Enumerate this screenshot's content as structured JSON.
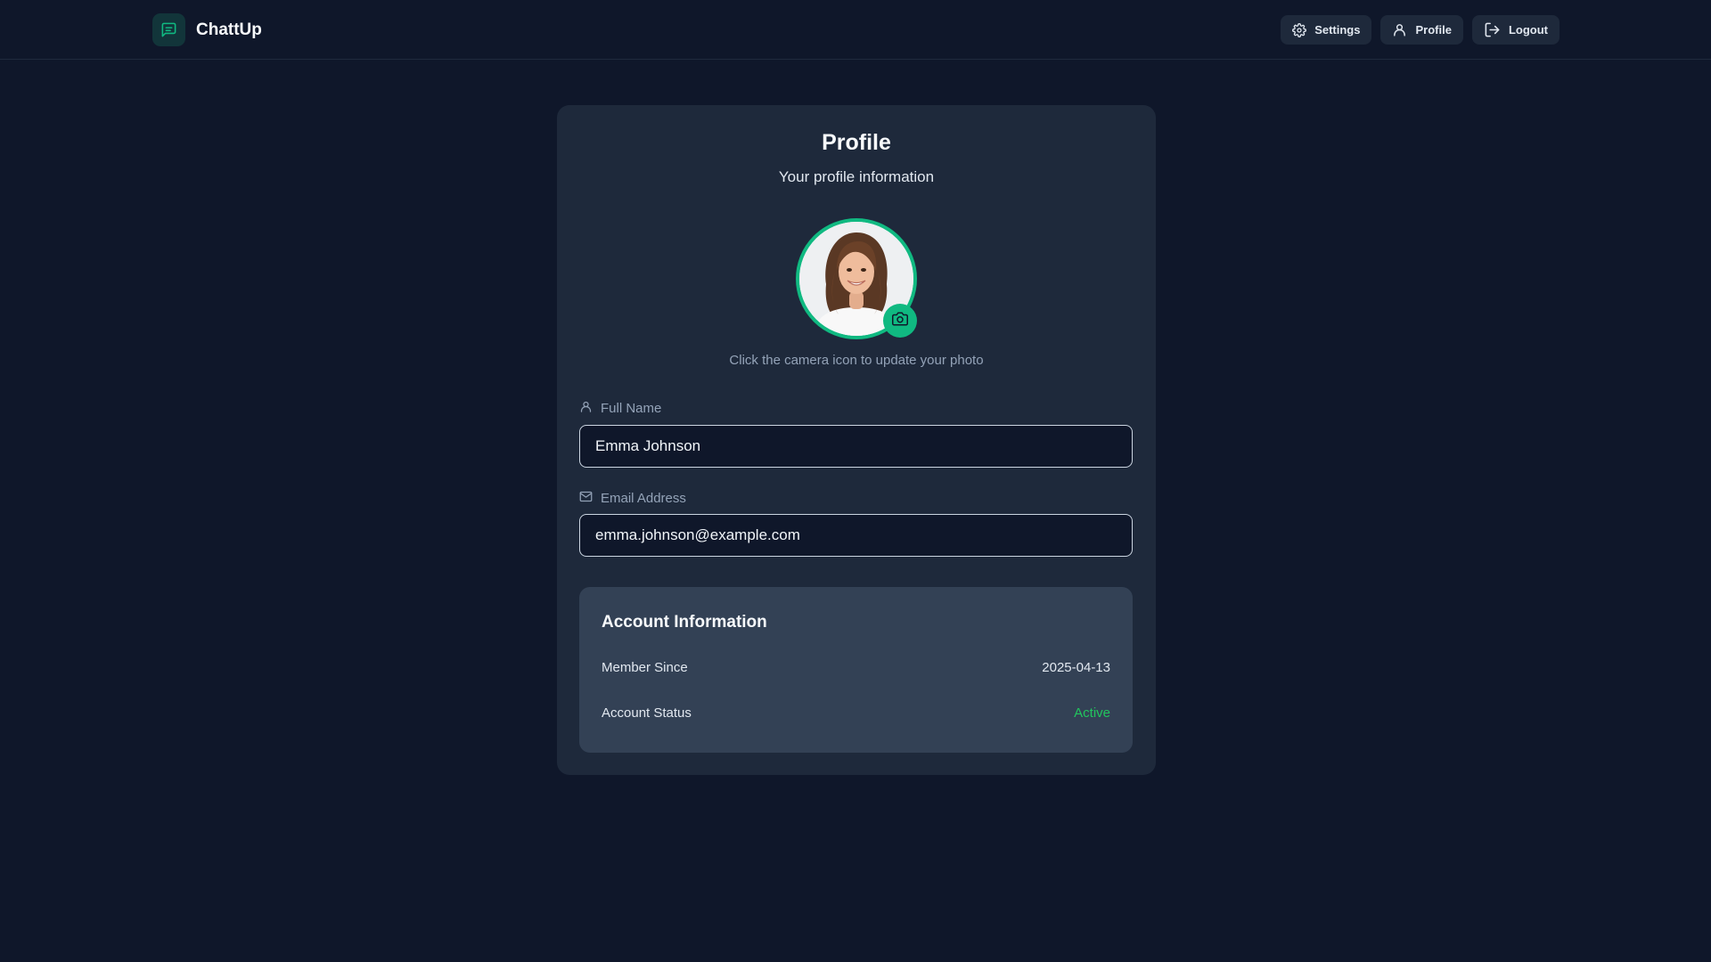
{
  "app": {
    "name": "ChattUp",
    "accent_color": "#10b981",
    "logo_icon": "message-square-icon"
  },
  "nav": {
    "settings_label": "Settings",
    "profile_label": "Profile",
    "logout_label": "Logout"
  },
  "profile": {
    "title": "Profile",
    "subtitle": "Your profile information",
    "avatar_alt": "Profile photo of a smiling woman",
    "camera_hint": "Click the camera icon to update your photo",
    "full_name_label": "Full Name",
    "full_name_value": "Emma Johnson",
    "email_label": "Email Address",
    "email_value": "emma.johnson@example.com"
  },
  "account": {
    "title": "Account Information",
    "member_since_label": "Member Since",
    "member_since_value": "2025-04-13",
    "status_label": "Account Status",
    "status_value": "Active",
    "status_color": "#22c55e"
  }
}
